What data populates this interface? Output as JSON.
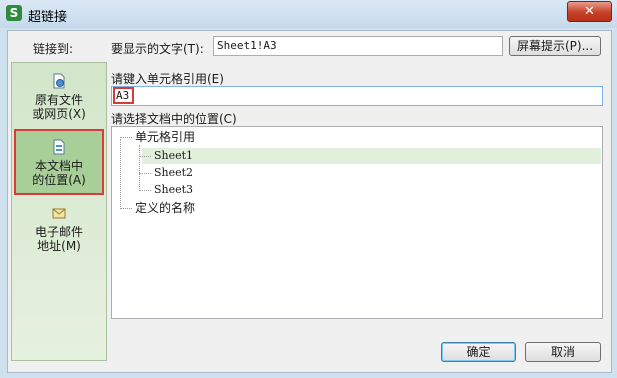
{
  "window": {
    "title": "超链接",
    "app_icon_letter": "S",
    "close_glyph": "✕"
  },
  "link_to": {
    "label": "链接到:"
  },
  "display_text": {
    "label": "要显示的文字(T):",
    "value": "Sheet1!A3"
  },
  "screentip_button": {
    "label": "屏幕提示(P)..."
  },
  "link_types": [
    {
      "line1": "原有文件",
      "line2": "或网页(X)",
      "icon": "file-web-icon",
      "selected": false
    },
    {
      "line1": "本文档中",
      "line2": "的位置(A)",
      "icon": "document-place-icon",
      "selected": true
    },
    {
      "line1": "电子邮件",
      "line2": "地址(M)",
      "icon": "email-icon",
      "selected": false
    }
  ],
  "cell_reference": {
    "label": "请键入单元格引用(E)",
    "value": "A3"
  },
  "location": {
    "label": "请选择文档中的位置(C)",
    "tree": {
      "group1": "单元格引用",
      "sheets": [
        "Sheet1",
        "Sheet2",
        "Sheet3"
      ],
      "selected_sheet": "Sheet1",
      "group2": "定义的名称"
    }
  },
  "buttons": {
    "ok": "确定",
    "cancel": "取消"
  },
  "colors": {
    "highlight_border": "#d93a3a",
    "panel_green": "#d3e6c9",
    "selected_green": "#a9cf99"
  }
}
